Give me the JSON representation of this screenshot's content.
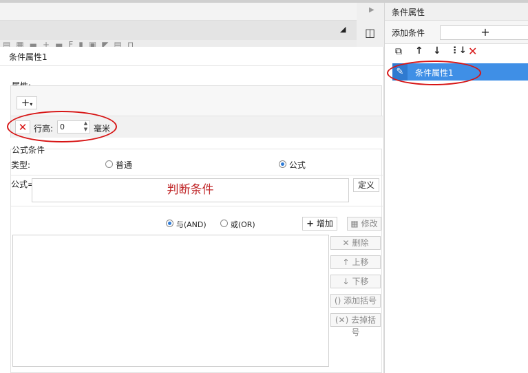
{
  "right_panel": {
    "title": "条件属性",
    "add_condition_label": "添加条件",
    "add_button": "+",
    "tools": [
      "copy-icon",
      "arrow-up-icon",
      "arrow-down-icon",
      "sort-icon",
      "close-icon"
    ],
    "selected_item": "条件属性1"
  },
  "panel": {
    "title": "条件属性1",
    "attributes": {
      "legend": "属性:",
      "add_button": "+",
      "row_height_label": "行高:",
      "row_height_value": "0",
      "unit": "毫米"
    },
    "formula_condition": {
      "legend": "公式条件",
      "type_label": "类型:",
      "option_normal": "普通",
      "option_formula": "公式",
      "selected_type": "公式",
      "formula_label": "公式=",
      "formula_value": "判断条件",
      "define_button": "定义",
      "and_option": "与(AND)",
      "or_option": "或(OR)",
      "selected_logic": "与(AND)",
      "add_button": "增加",
      "modify_button": "修改",
      "side_buttons": [
        "删除",
        "上移",
        "下移",
        "添加括号",
        "去掉括号"
      ]
    }
  },
  "colors": {
    "accent": "#3f8fe6",
    "annotation_red": "#d71414",
    "formula_text": "#c0282a"
  }
}
